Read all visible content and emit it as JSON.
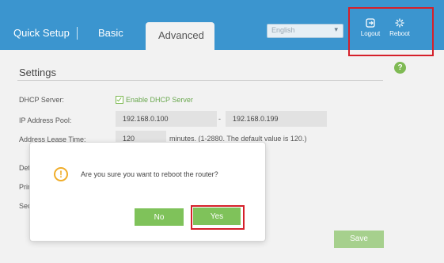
{
  "tabs": {
    "quick_setup": "Quick Setup",
    "basic": "Basic",
    "advanced": "Advanced"
  },
  "language": {
    "selected": "English"
  },
  "toolbar": {
    "logout_label": "Logout",
    "reboot_label": "Reboot"
  },
  "settings": {
    "title": "Settings",
    "dhcp_server_label": "DHCP Server:",
    "enable_dhcp_label": "Enable DHCP Server",
    "enable_dhcp_checked": true,
    "ip_pool_label": "IP Address Pool:",
    "ip_pool_start": "192.168.0.100",
    "ip_pool_end": "192.168.0.199",
    "ip_pool_separator": "-",
    "lease_time_label": "Address Lease Time:",
    "lease_time_value": "120",
    "lease_time_note": "minutes. (1-2880. The default value is 120.)",
    "default_gateway_label_partial": "Def",
    "primary_dns_label_partial": "Prim",
    "secondary_dns_label_partial": "Sec",
    "save_label": "Save"
  },
  "dialog": {
    "message": "Are you sure you want to reboot the router?",
    "no_label": "No",
    "yes_label": "Yes"
  },
  "help_label": "?",
  "colors": {
    "topbar": "#3b95cf",
    "accent_green": "#7fc25a",
    "highlight_red": "#d5202a",
    "warning": "#f0ad2a"
  }
}
